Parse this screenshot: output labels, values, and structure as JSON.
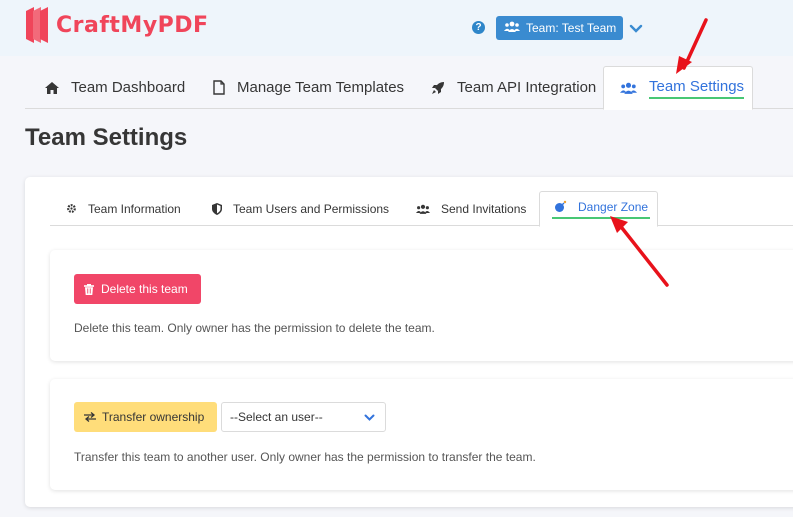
{
  "brand": {
    "name": "CraftMyPDF",
    "logo_icon": "craftmypdf-logo"
  },
  "header": {
    "help_icon": "question-circle-icon",
    "team_button_label": "Team: Test Team",
    "team_icon": "users-icon",
    "dropdown_icon": "chevron-down-icon"
  },
  "main_tabs": [
    {
      "label": "Team Dashboard",
      "icon": "home-icon"
    },
    {
      "label": "Manage Team Templates",
      "icon": "file-icon"
    },
    {
      "label": "Team API Integration",
      "icon": "rocket-icon"
    },
    {
      "label": "Team Settings",
      "icon": "users-icon",
      "active": true
    }
  ],
  "page_title": "Team Settings",
  "sub_tabs": [
    {
      "label": "Team Information",
      "icon": "gear-icon"
    },
    {
      "label": "Team Users and Permissions",
      "icon": "shield-icon"
    },
    {
      "label": "Send Invitations",
      "icon": "users-icon"
    },
    {
      "label": "Danger Zone",
      "icon": "bomb-icon",
      "active": true
    }
  ],
  "danger_zone": {
    "delete": {
      "button_label": "Delete this team",
      "icon": "trash-icon",
      "description": "Delete this team. Only owner has the permission to delete the team."
    },
    "transfer": {
      "button_label": "Transfer ownership",
      "icon": "exchange-icon",
      "select_value": "--Select an user--",
      "description": "Transfer this team to another user. Only owner has the permission to transfer the team."
    }
  },
  "colors": {
    "primary": "#3273dc",
    "danger": "#f14668",
    "warning": "#ffdd7a",
    "success": "#48c774",
    "brand": "#f0455a",
    "annotation_arrow": "#e8121b"
  }
}
